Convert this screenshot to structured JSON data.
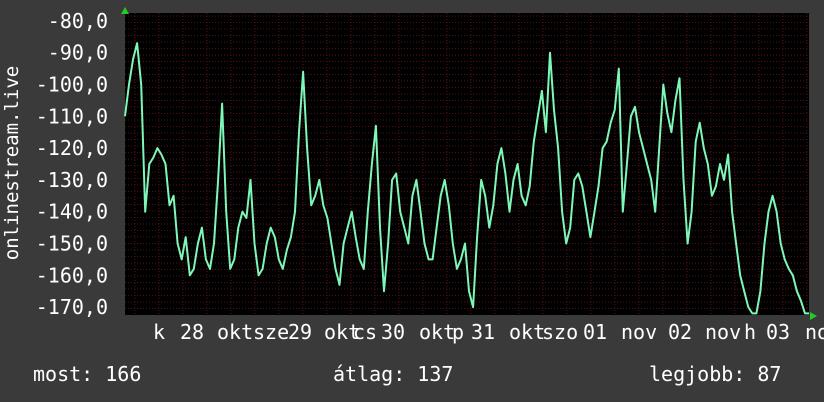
{
  "chart_data": {
    "type": "line",
    "ylabel": "onlinestream.live",
    "y_ticks": [
      "-80,0",
      "-90,0",
      "-100,0",
      "-110,0",
      "-120,0",
      "-130,0",
      "-140,0",
      "-150,0",
      "-160,0",
      "-170,0"
    ],
    "ylim": [
      -172.5,
      -77.5
    ],
    "x_tick_labels": [
      "k",
      "28",
      "okt",
      "sze",
      "29",
      "okt",
      "cs",
      "30",
      "okt",
      "p",
      "31",
      "okt",
      "szo",
      "01",
      "nov",
      "02",
      "nov",
      "h",
      "03",
      "no"
    ],
    "grid": true,
    "colors": {
      "line": "#7ef8b8",
      "background": "#000000",
      "grid": "#5a1010",
      "axis_marker": "#22cc22"
    },
    "series": [
      {
        "x": [
          0,
          4,
          8,
          12,
          16,
          20,
          24,
          28,
          32,
          36,
          40,
          44,
          48,
          52,
          56,
          60,
          64,
          68,
          72,
          76,
          80,
          84,
          88,
          92,
          96,
          100,
          104,
          108,
          112,
          116,
          120,
          124,
          128,
          132,
          136,
          140,
          144,
          148,
          152,
          156,
          160,
          164,
          168,
          172,
          176,
          180,
          184,
          188,
          192,
          196,
          200,
          204,
          208,
          212,
          216,
          220,
          224,
          228,
          232,
          236,
          240,
          244,
          248,
          252,
          256,
          260,
          264,
          268,
          272,
          276,
          280,
          284,
          288,
          292,
          296,
          300,
          304,
          308,
          312,
          316,
          320,
          324,
          328,
          332,
          336,
          340,
          344,
          348,
          352,
          356,
          360,
          364,
          368,
          372,
          376,
          380,
          384,
          388,
          392,
          396,
          400,
          404,
          408,
          412,
          416,
          420,
          424,
          428,
          432,
          436,
          440,
          444,
          448,
          452,
          456,
          460,
          464,
          468,
          472,
          476,
          480,
          484,
          488,
          492,
          496,
          500,
          504,
          508,
          512,
          516,
          520,
          524,
          528,
          532,
          536,
          540,
          544,
          548,
          552,
          556,
          560,
          564,
          568,
          572,
          576,
          580,
          584,
          588,
          592,
          596,
          600,
          604,
          608,
          612,
          616,
          620,
          624,
          628,
          632,
          636,
          640,
          644,
          648,
          652,
          656,
          660,
          664,
          668,
          672,
          676
        ],
        "values": [
          -110,
          -100,
          -92,
          -87,
          -100,
          -140,
          -125,
          -123,
          -120,
          -122,
          -125,
          -138,
          -135,
          -150,
          -155,
          -148,
          -160,
          -158,
          -150,
          -145,
          -155,
          -158,
          -150,
          -130,
          -106,
          -140,
          -158,
          -155,
          -145,
          -140,
          -142,
          -130,
          -150,
          -160,
          -158,
          -150,
          -145,
          -148,
          -155,
          -158,
          -152,
          -148,
          -140,
          -115,
          -96,
          -120,
          -138,
          -135,
          -130,
          -138,
          -142,
          -150,
          -158,
          -163,
          -150,
          -145,
          -140,
          -148,
          -155,
          -158,
          -140,
          -125,
          -113,
          -145,
          -165,
          -150,
          -130,
          -128,
          -140,
          -145,
          -150,
          -135,
          -130,
          -140,
          -150,
          -155,
          -155,
          -145,
          -135,
          -130,
          -138,
          -150,
          -158,
          -155,
          -150,
          -165,
          -170,
          -148,
          -130,
          -135,
          -145,
          -138,
          -125,
          -120,
          -128,
          -140,
          -130,
          -125,
          -135,
          -138,
          -132,
          -118,
          -110,
          -102,
          -115,
          -90,
          -108,
          -120,
          -140,
          -150,
          -145,
          -130,
          -128,
          -132,
          -140,
          -148,
          -140,
          -132,
          -120,
          -118,
          -112,
          -108,
          -95,
          -140,
          -125,
          -110,
          -107,
          -115,
          -120,
          -125,
          -130,
          -140,
          -120,
          -100,
          -109,
          -115,
          -105,
          -98,
          -130,
          -150,
          -140,
          -118,
          -112,
          -120,
          -125,
          -135,
          -132,
          -125,
          -130,
          -122,
          -140,
          -150,
          -160,
          -165,
          -170,
          -172,
          -172,
          -165,
          -150,
          -140,
          -135,
          -140,
          -150,
          -155,
          -158,
          -160,
          -165,
          -168,
          -172,
          -172
        ]
      }
    ]
  },
  "stats": {
    "now": "most: 166",
    "avg": "átlag: 137",
    "best": "legjobb: 87"
  }
}
